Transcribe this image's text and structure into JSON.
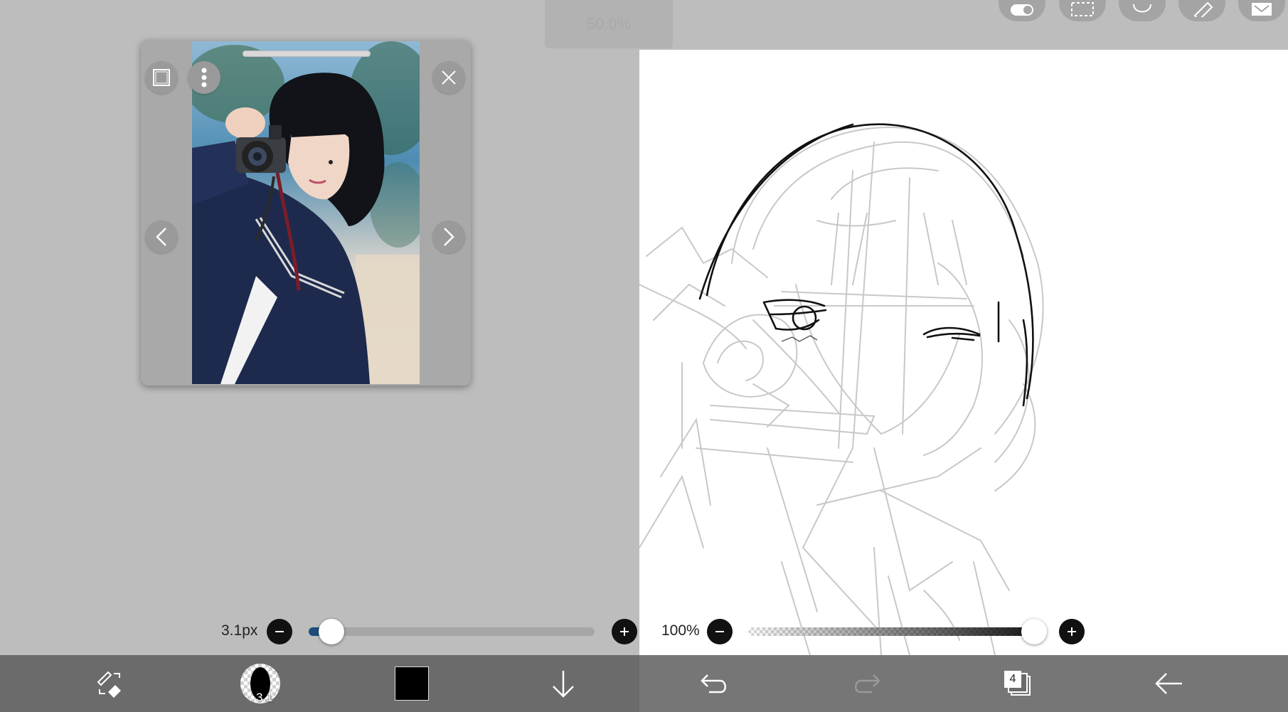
{
  "app": {
    "zoom_indicator": "50.0%"
  },
  "top_tools": [
    {
      "name": "toggle-icon"
    },
    {
      "name": "selection-icon"
    },
    {
      "name": "lasso-icon"
    },
    {
      "name": "ruler-icon"
    },
    {
      "name": "material-icon"
    }
  ],
  "reference_window": {
    "image_alt": "Reference photo: girl in navy sailor uniform holding a camera, one eye closed",
    "buttons": [
      "frame-button",
      "more-button",
      "close-button",
      "prev-button",
      "next-button"
    ]
  },
  "brush_size_slider": {
    "label": "3.1px",
    "value": 0.08
  },
  "opacity_slider": {
    "label": "100%",
    "value": 1.0
  },
  "bottom_toolbar": {
    "brush_size_badge": "3.1",
    "current_color": "#000000",
    "layer_count": "4"
  },
  "colors": {
    "background_gray": "#bdbdbd",
    "toolbar_dark": "#6b6b6b",
    "slider_fill": "#1d4d7a",
    "canvas": "#ffffff"
  }
}
